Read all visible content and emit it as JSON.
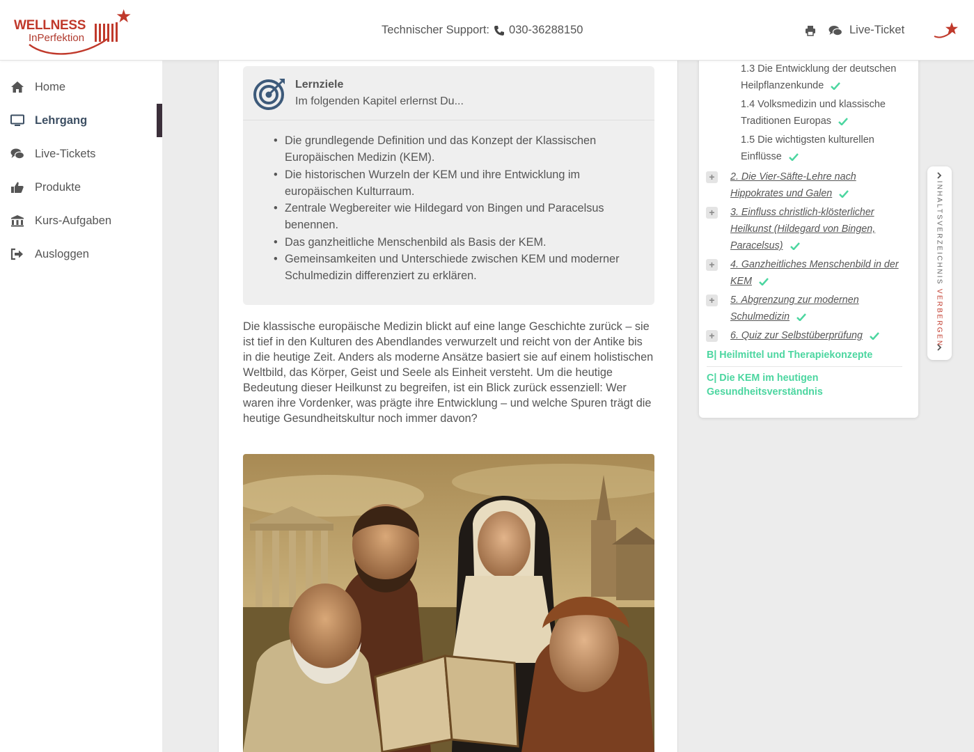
{
  "header": {
    "logo_line1": "WELLNESS",
    "logo_line2": "InPerfektion",
    "support_label": "Technischer Support:",
    "support_phone": "030-36288150",
    "live_ticket_label": "Live-Ticket"
  },
  "sidebar": {
    "items": [
      {
        "label": "Home",
        "icon": "home-icon"
      },
      {
        "label": "Lehrgang",
        "icon": "monitor-icon",
        "active": true
      },
      {
        "label": "Live-Tickets",
        "icon": "chat-icon"
      },
      {
        "label": "Produkte",
        "icon": "thumbs-up-icon"
      },
      {
        "label": "Kurs-Aufgaben",
        "icon": "university-icon"
      },
      {
        "label": "Ausloggen",
        "icon": "logout-icon"
      }
    ]
  },
  "goals": {
    "title": "Lernziele",
    "subtitle": "Im folgenden Kapitel erlernst Du...",
    "items": [
      "Die grundlegende Definition und das Konzept der Klassischen Europäischen Medizin (KEM).",
      "Die historischen Wurzeln der KEM und ihre Entwicklung im europäischen Kulturraum.",
      "Zentrale Wegbereiter wie Hildegard von Bingen und Paracelsus benennen.",
      "Das ganzheitliche Menschenbild als Basis der KEM.",
      "Gemeinsamkeiten und Unterschiede zwischen KEM und moderner Schulmedizin differenziert zu erklären."
    ]
  },
  "intro_text": "Die klassische europäische Medizin blickt auf eine lange Geschichte zurück – sie ist tief in den Kulturen des Abendlandes verwurzelt und reicht von der Antike bis in die heutige Zeit. Anders als moderne Ansätze basiert sie auf einem holistischen Weltbild, das Körper, Geist und Seele als Einheit versteht. Um die heutige Bedeutung dieser Heilkunst zu begreifen, ist ein Blick zurück essenziell: Wer waren ihre Vordenker, was prägte ihre Entwicklung – und welche Spuren trägt die heutige Gesundheitskultur noch immer davon?",
  "toc": {
    "subitems": [
      "1.3 Die Entwicklung der deutschen Heilpflanzenkunde",
      "1.4 Volksmedizin und klassische Traditionen Europas",
      "1.5 Die wichtigsten kulturellen Einflüsse"
    ],
    "chapters": [
      "2. Die Vier-Säfte-Lehre nach Hippokrates und Galen",
      "3. Einfluss christlich-klösterlicher Heilkunst (Hildegard von Bingen, Paracelsus)",
      "4. Ganzheitliches Menschenbild in der KEM",
      "5. Abgrenzung zur modernen Schulmedizin",
      "6. Quiz zur Selbstüberprüfung"
    ],
    "sections": [
      "B| Heilmittel und Therapiekonzepte",
      "C| Die KEM im heutigen Gesundheitsverständnis"
    ],
    "expand_symbol": "+",
    "tab_label": "INHALTSVERZEICHNIS",
    "tab_action": "VERBERGEN"
  },
  "colors": {
    "brand_red": "#c0392b",
    "accent_green": "#4cd6a0",
    "nav_active": "#3d4f63"
  }
}
